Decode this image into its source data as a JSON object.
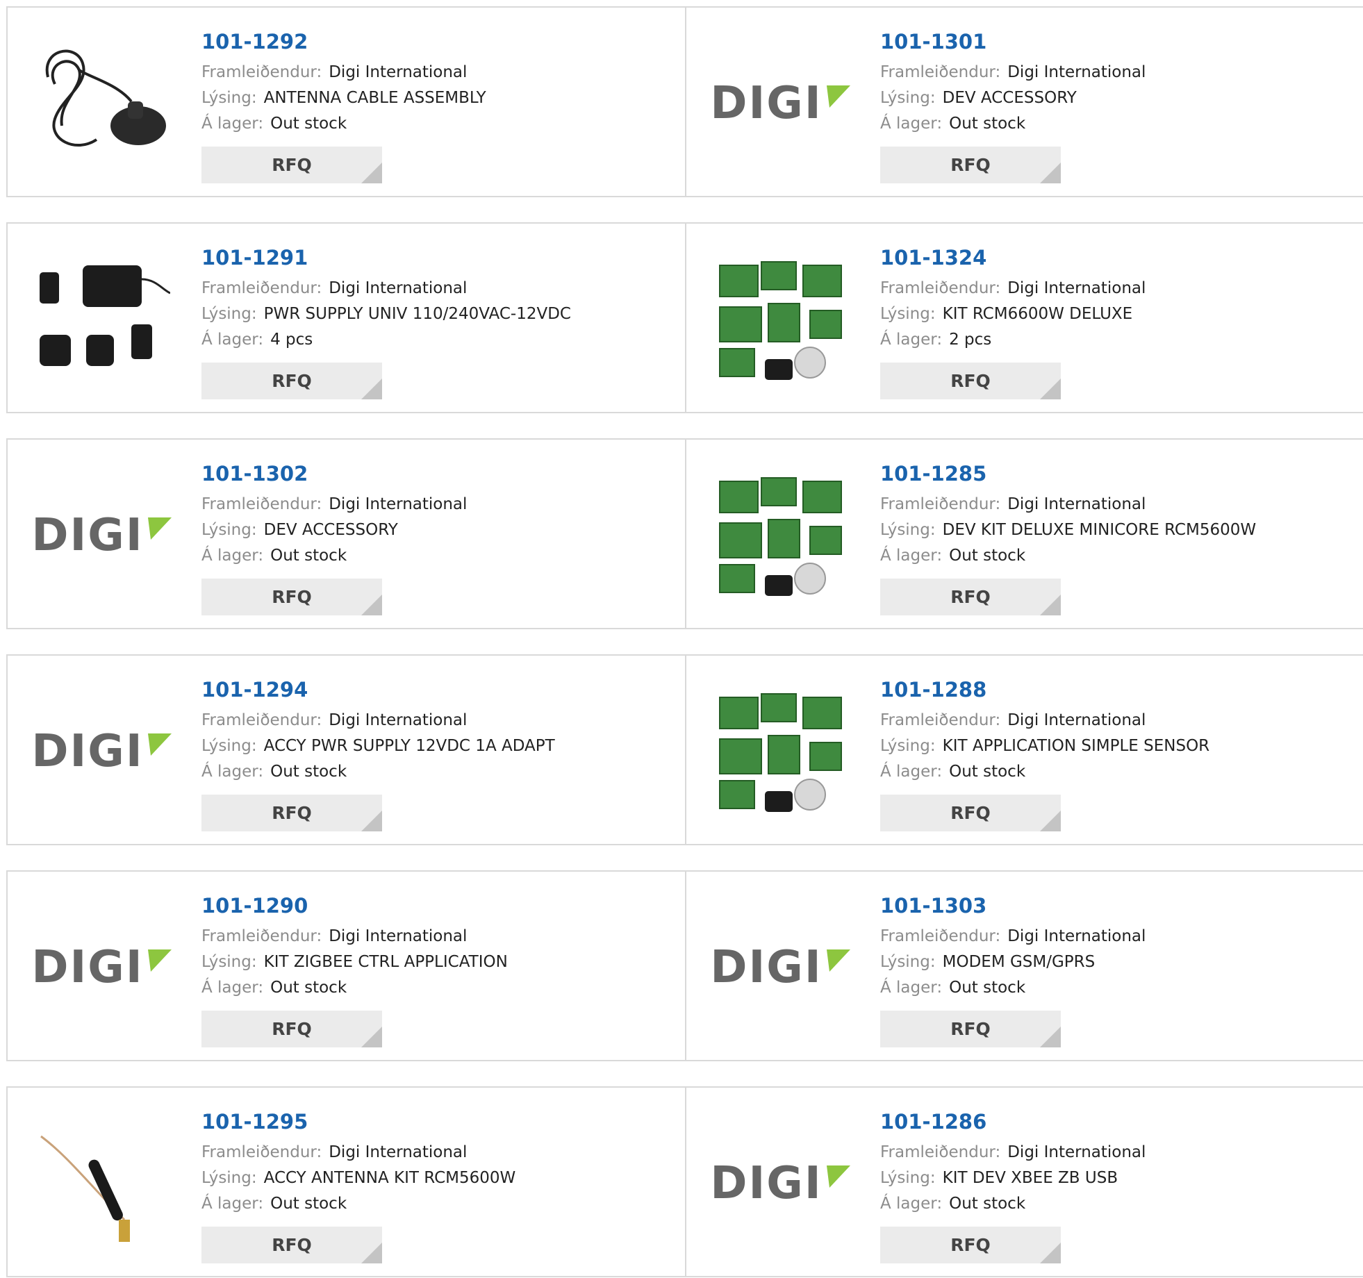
{
  "labels": {
    "manufacturer": "Framleiðendur:",
    "description": "Lýsing:",
    "stock": "Á lager:",
    "rfq": "RFQ"
  },
  "brand": {
    "logo_text": "DIGI",
    "accent": "#8dc63f"
  },
  "colors": {
    "part_number": "#1a63ad",
    "label": "#8c8c8c",
    "rfq_bg": "#ebebeb"
  },
  "products": [
    {
      "pn": "101-1292",
      "manufacturer": "Digi International",
      "description": "ANTENNA CABLE ASSEMBLY",
      "stock": "Out stock",
      "image": "antenna-cable-photo"
    },
    {
      "pn": "101-1301",
      "manufacturer": "Digi International",
      "description": "DEV ACCESSORY",
      "stock": "Out stock",
      "image": "digi-logo"
    },
    {
      "pn": "101-1291",
      "manufacturer": "Digi International",
      "description": "PWR SUPPLY UNIV 110/240VAC-12VDC",
      "stock": "4 pcs",
      "image": "power-supply-photo"
    },
    {
      "pn": "101-1324",
      "manufacturer": "Digi International",
      "description": "KIT RCM6600W DELUXE",
      "stock": "2 pcs",
      "image": "dev-kit-photo"
    },
    {
      "pn": "101-1302",
      "manufacturer": "Digi International",
      "description": "DEV ACCESSORY",
      "stock": "Out stock",
      "image": "digi-logo"
    },
    {
      "pn": "101-1285",
      "manufacturer": "Digi International",
      "description": "DEV KIT DELUXE MINICORE RCM5600W",
      "stock": "Out stock",
      "image": "dev-kit-photo"
    },
    {
      "pn": "101-1294",
      "manufacturer": "Digi International",
      "description": "ACCY PWR SUPPLY 12VDC 1A ADAPT",
      "stock": "Out stock",
      "image": "digi-logo"
    },
    {
      "pn": "101-1288",
      "manufacturer": "Digi International",
      "description": "KIT APPLICATION SIMPLE SENSOR",
      "stock": "Out stock",
      "image": "dev-kit-photo"
    },
    {
      "pn": "101-1290",
      "manufacturer": "Digi International",
      "description": "KIT ZIGBEE CTRL APPLICATION",
      "stock": "Out stock",
      "image": "digi-logo"
    },
    {
      "pn": "101-1303",
      "manufacturer": "Digi International",
      "description": "MODEM GSM/GPRS",
      "stock": "Out stock",
      "image": "digi-logo"
    },
    {
      "pn": "101-1295",
      "manufacturer": "Digi International",
      "description": "ACCY ANTENNA KIT RCM5600W",
      "stock": "Out stock",
      "image": "antenna-photo"
    },
    {
      "pn": "101-1286",
      "manufacturer": "Digi International",
      "description": "KIT DEV XBEE ZB USB",
      "stock": "Out stock",
      "image": "digi-logo"
    }
  ]
}
